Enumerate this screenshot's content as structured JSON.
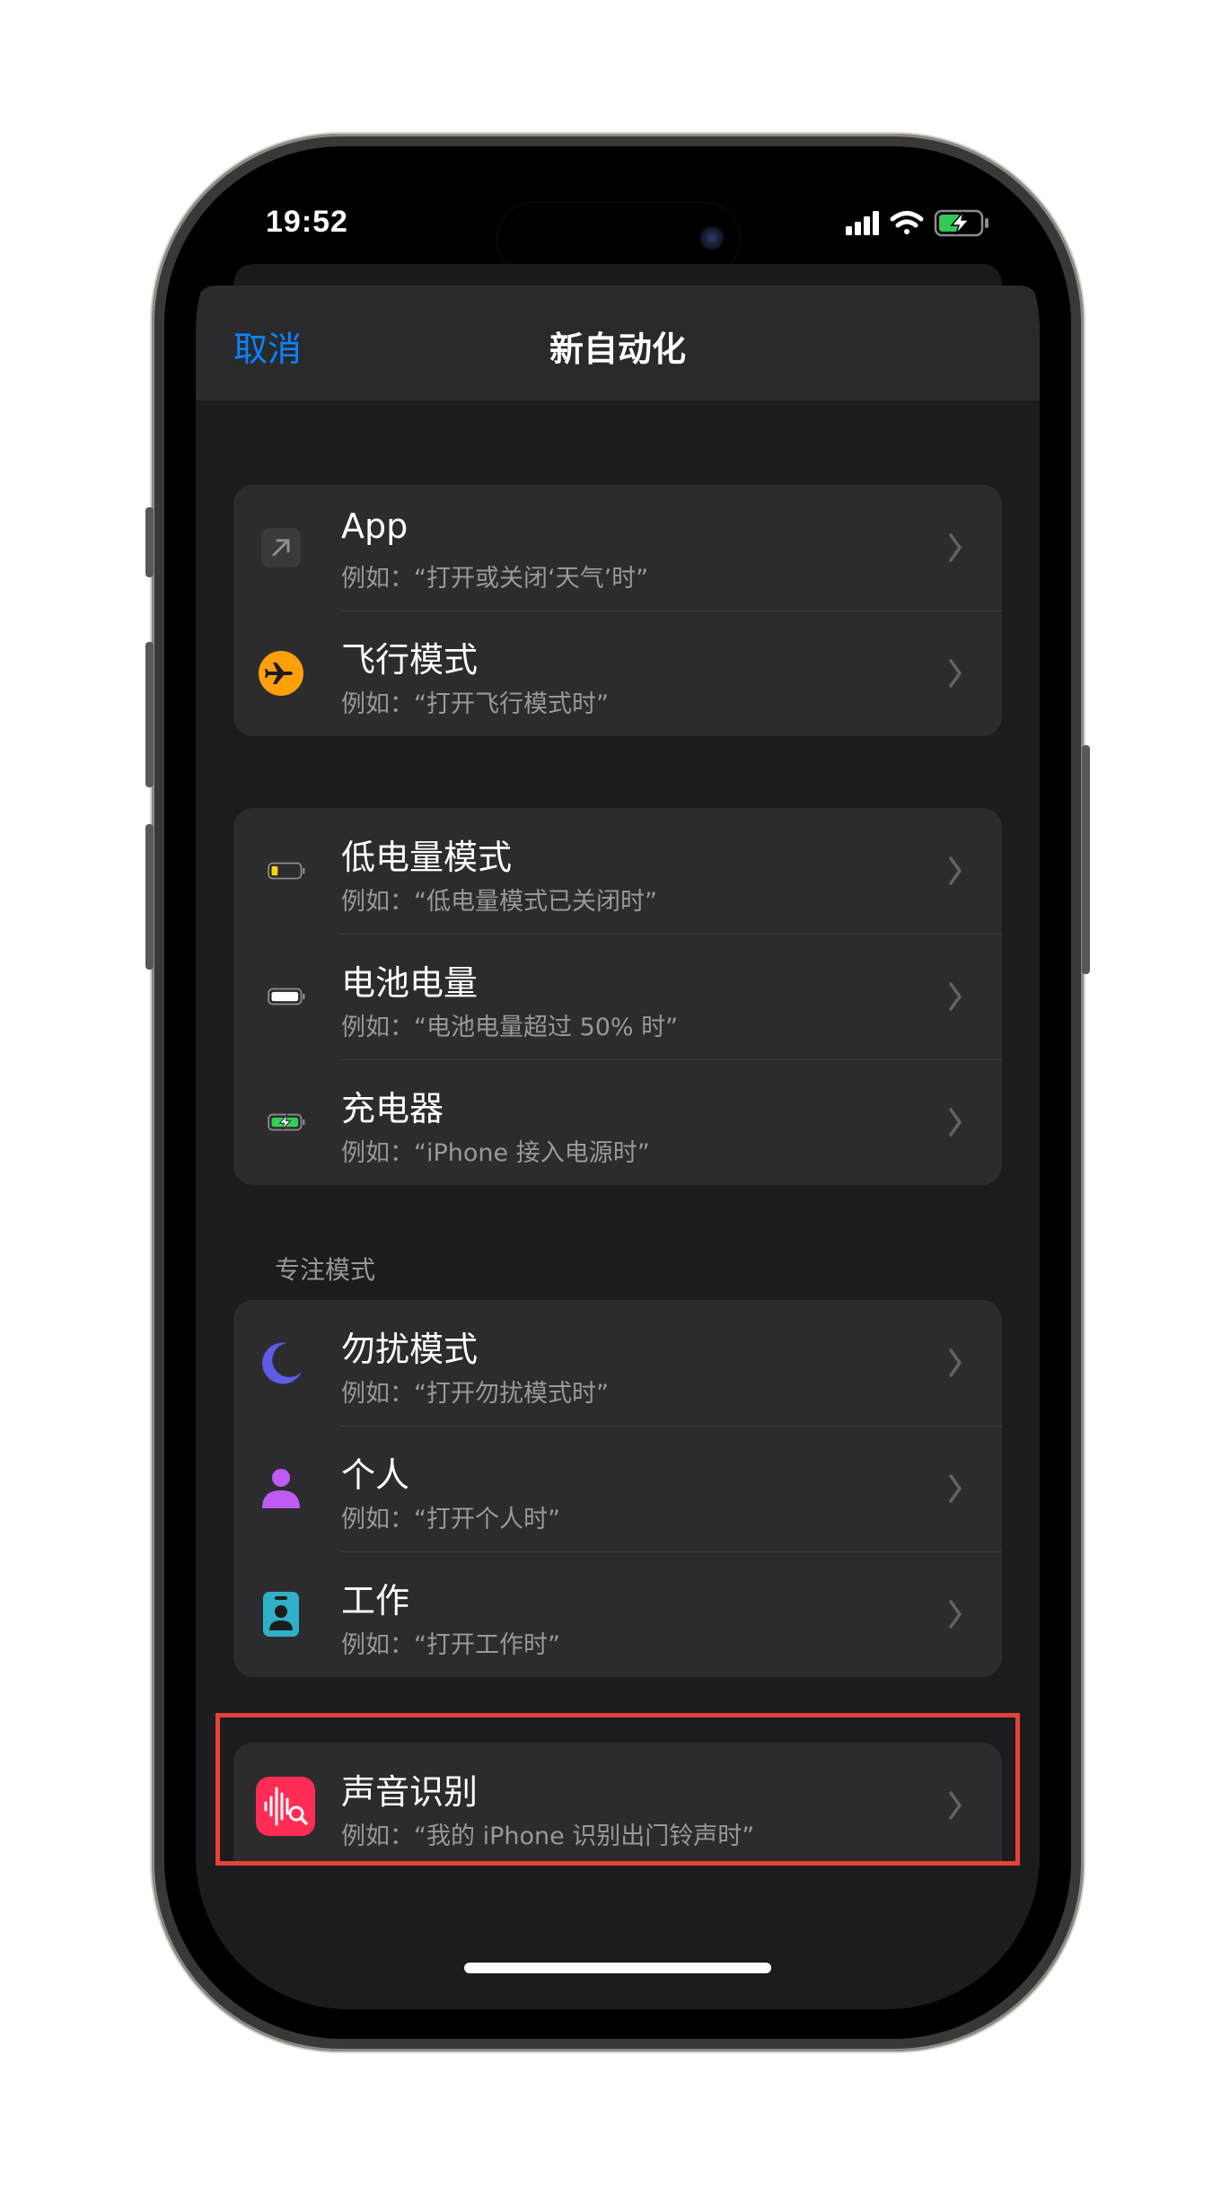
{
  "status_bar": {
    "time": "19:52"
  },
  "navbar": {
    "cancel_label": "取消",
    "title": "新自动化"
  },
  "groups": [
    {
      "header": "",
      "items": [
        {
          "icon": "app-arrow-icon",
          "title": "App",
          "subtitle": "例如：“打开或关闭‘天气’时”"
        },
        {
          "icon": "airplane-icon",
          "title": "飞行模式",
          "subtitle": "例如：“打开飞行模式时”"
        }
      ]
    },
    {
      "header": "",
      "items": [
        {
          "icon": "low-battery-icon",
          "title": "低电量模式",
          "subtitle": "例如：“低电量模式已关闭时”"
        },
        {
          "icon": "battery-icon",
          "title": "电池电量",
          "subtitle": "例如：“电池电量超过 50% 时”"
        },
        {
          "icon": "charging-battery-icon",
          "title": "充电器",
          "subtitle": "例如：“iPhone 接入电源时”"
        }
      ]
    },
    {
      "header": "专注模式",
      "items": [
        {
          "icon": "moon-icon",
          "title": "勿扰模式",
          "subtitle": "例如：“打开勿扰模式时”"
        },
        {
          "icon": "person-icon",
          "title": "个人",
          "subtitle": "例如：“打开个人时”"
        },
        {
          "icon": "id-badge-icon",
          "title": "工作",
          "subtitle": "例如：“打开工作时”"
        }
      ]
    },
    {
      "header": "",
      "items": [
        {
          "icon": "sound-recognition-icon",
          "title": "声音识别",
          "subtitle": "例如：“我的 iPhone 识别出门铃声时”"
        }
      ]
    }
  ],
  "colors": {
    "accent": "#0a84ff",
    "background": "#1c1c1e",
    "cell": "#2c2c2e",
    "highlight": "#e5423a",
    "airplane": "#ff9f0a",
    "focus_moon": "#5e5ce6",
    "focus_personal": "#bf5af2",
    "focus_work": "#30b0c7",
    "sound_recognition": "#ff2d55"
  }
}
